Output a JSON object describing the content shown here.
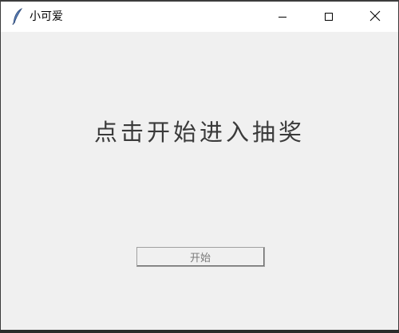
{
  "window": {
    "title": "小可爱",
    "app_icon": "feather-icon",
    "controls": {
      "minimize": "minimize-icon",
      "maximize": "maximize-icon",
      "close": "close-icon"
    }
  },
  "main": {
    "heading": "点击开始进入抽奖",
    "start_button_label": "开始"
  },
  "colors": {
    "window_bg": "#f0f0f0",
    "titlebar_bg": "#ffffff",
    "heading_text": "#3a3a3a",
    "button_text": "#7a7a7a"
  }
}
